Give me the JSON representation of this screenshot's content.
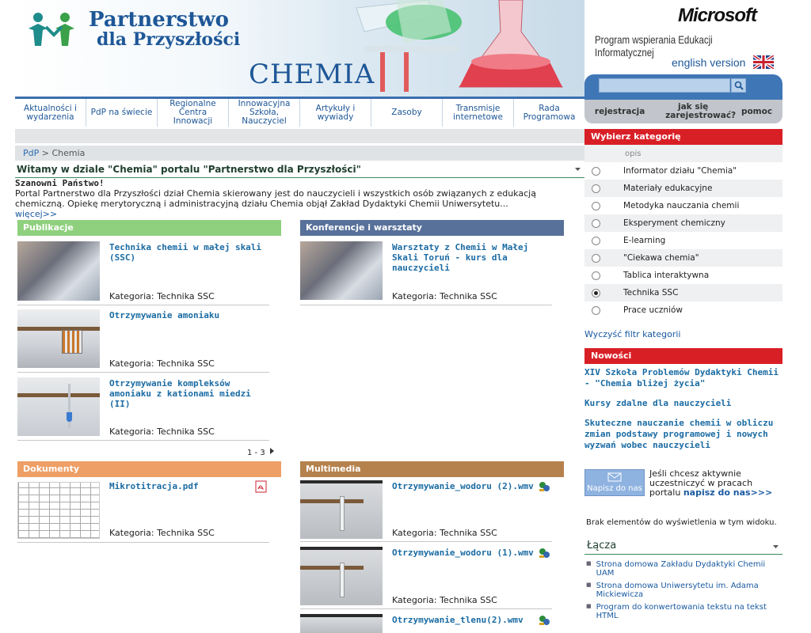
{
  "brand": {
    "name_line1": "Partnerstwo",
    "name_line2": "dla Przyszłości",
    "section": "CHEMIA",
    "ms": "Microsoft",
    "ms_sub": "Program wspierania Edukacji Informatycznej",
    "english": "english version"
  },
  "nav": [
    "Aktualności i wydarzenia",
    "PdP na świecie",
    "Regionalne Centra Innowacji",
    "Innowacyjna Szkoła, Nauczyciel",
    "Artykuły i wywiady",
    "Zasoby",
    "Transmisje internetowe",
    "Rada Programowa"
  ],
  "rnav": {
    "register": "rejestracja",
    "how": "jak się zarejestrować?",
    "help": "pomoc",
    "search_placeholder": ""
  },
  "breadcrumb": {
    "root": "PdP",
    "sep": ">",
    "current": "Chemia"
  },
  "welcome": {
    "title": "Witamy w dziale \"Chemia\" portalu \"Partnerstwo dla Przyszłości\"",
    "greeting": "Szanowni Państwo!",
    "body": "Portal Partnerstwo dla Przyszłości dział Chemia skierowany jest do nauczycieli i wszystkich osób związanych z edukacją chemiczną. Opiekę merytoryczną i administracyjną działu Chemia objął Zakład Dydaktyki Chemii Uniwersytetu...",
    "more": "więcej>>"
  },
  "publikacje": {
    "title": "Publikacje",
    "items": [
      {
        "title": "Technika chemii w małej skali (SSC)",
        "cat": "Kategoria: Technika SSC"
      },
      {
        "title": "Otrzymywanie amoniaku",
        "cat": "Kategoria: Technika SSC"
      },
      {
        "title": "Otrzymywanie kompleksów amoniaku z kationami miedzi (II)",
        "cat": "Kategoria: Technika SSC"
      }
    ],
    "pager": "1 - 3"
  },
  "konferencje": {
    "title": "Konferencje i warsztaty",
    "items": [
      {
        "title": "Warsztaty z Chemii w Małej Skali Toruń - kurs dla nauczycieli",
        "cat": "Kategoria: Technika SSC"
      }
    ]
  },
  "dokumenty": {
    "title": "Dokumenty",
    "items": [
      {
        "title": "Mikrotitracja.pdf",
        "cat": "Kategoria: Technika SSC"
      }
    ]
  },
  "multimedia": {
    "title": "Multimedia",
    "items": [
      {
        "title": "Otrzymywanie_wodoru (2).wmv",
        "cat": "Kategoria: Technika SSC"
      },
      {
        "title": "Otrzymywanie_wodoru (1).wmv",
        "cat": "Kategoria: Technika SSC"
      },
      {
        "title": "Otrzymywanie_tlenu(2).wmv",
        "cat": ""
      }
    ]
  },
  "categories": {
    "title": "Wybierz kategorię",
    "header": "opis",
    "items": [
      "Informator działu \"Chemia\"",
      "Materiały edukacyjne",
      "Metodyka nauczania chemii",
      "Eksperyment chemiczny",
      "E-learning",
      "\"Ciekawa chemia\"",
      "Tablica interaktywna",
      "Technika SSC",
      "Prace uczniów"
    ],
    "selected": 7,
    "clear": "Wyczyść filtr kategorii"
  },
  "news": {
    "title": "Nowości",
    "items": [
      "XIV Szkoła Problemów Dydaktyki Chemii - \"Chemia bliżej życia\"",
      "Kursy zdalne dla nauczycieli",
      "Skuteczne nauczanie chemii w obliczu zmian podstawy programowej i nowych wyzwań wobec nauczycieli"
    ]
  },
  "contact": {
    "button": "Napisz do nas",
    "text": "Jeśli chcesz aktywnie uczestniczyć w pracach portalu",
    "link": "napisz do nas>>>"
  },
  "empty": "Brak elementów do wyświetlenia w tym widoku.",
  "links": {
    "title": "Łącza",
    "items": [
      "Strona domowa Zakładu Dydaktyki Chemii UAM",
      "Strona domowa Uniwersytetu im. Adama Mickiewicza",
      "Program do konwertowania tekstu na tekst HTML"
    ]
  },
  "colors": {
    "accent": "#d91f26",
    "nav": "#1e5797",
    "publikacje": "#8fd07e",
    "konferencje": "#58719a",
    "dokumenty": "#ee9f66",
    "multimedia": "#b5824d"
  }
}
